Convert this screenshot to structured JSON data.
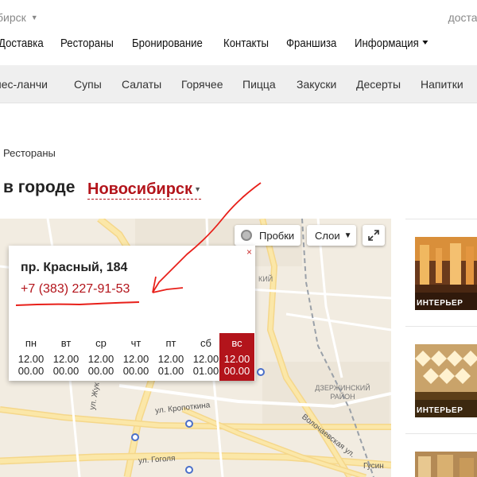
{
  "topbar": {
    "city": "бирск",
    "delivery": "достав"
  },
  "mainnav": {
    "items": [
      {
        "label": "Доставка"
      },
      {
        "label": "Рестораны"
      },
      {
        "label": "Бронирование"
      },
      {
        "label": "Контакты"
      },
      {
        "label": "Франшиза"
      },
      {
        "label": "Информация"
      }
    ]
  },
  "categories": [
    {
      "label": "нес-ланчи"
    },
    {
      "label": "Супы"
    },
    {
      "label": "Салаты"
    },
    {
      "label": "Горячее"
    },
    {
      "label": "Пицца"
    },
    {
      "label": "Закуски"
    },
    {
      "label": "Десерты"
    },
    {
      "label": "Напитки"
    }
  ],
  "breadcrumb": "Рестораны",
  "title": {
    "prefix": "в городе",
    "city": "Новосибирск"
  },
  "map": {
    "traffic_label": "Пробки",
    "layers_label": "Слои",
    "labels": {
      "district": "ДЗЕРЖИНСКИЙ РАЙОН",
      "kropotkina": "ул. Кропоткина",
      "gogolya": "ул. Гоголя",
      "volochaevskaya": "Волочаевская ул.",
      "gusin": "Гусин",
      "zhuk": "ул. Жук",
      "kiy": "КИЙ"
    }
  },
  "balloon": {
    "address": "пр. Красный, 184",
    "phone": "+7 (383) 227-91-53",
    "close": "×",
    "schedule": [
      {
        "day": "пн",
        "open": "12.00",
        "close": "00.00",
        "active": false
      },
      {
        "day": "вт",
        "open": "12.00",
        "close": "00.00",
        "active": false
      },
      {
        "day": "ср",
        "open": "12.00",
        "close": "00.00",
        "active": false
      },
      {
        "day": "чт",
        "open": "12.00",
        "close": "00.00",
        "active": false
      },
      {
        "day": "пт",
        "open": "12.00",
        "close": "01.00",
        "active": false
      },
      {
        "day": "сб",
        "open": "12.00",
        "close": "01.00",
        "active": false
      },
      {
        "day": "вс",
        "open": "12.00",
        "close": "00.00",
        "active": true
      }
    ]
  },
  "cards": [
    {
      "label": "ИНТЕРЬЕР"
    },
    {
      "label": "ИНТЕРЬЕР"
    }
  ],
  "colors": {
    "accent": "#b3141b",
    "annotation": "#e8201a"
  }
}
